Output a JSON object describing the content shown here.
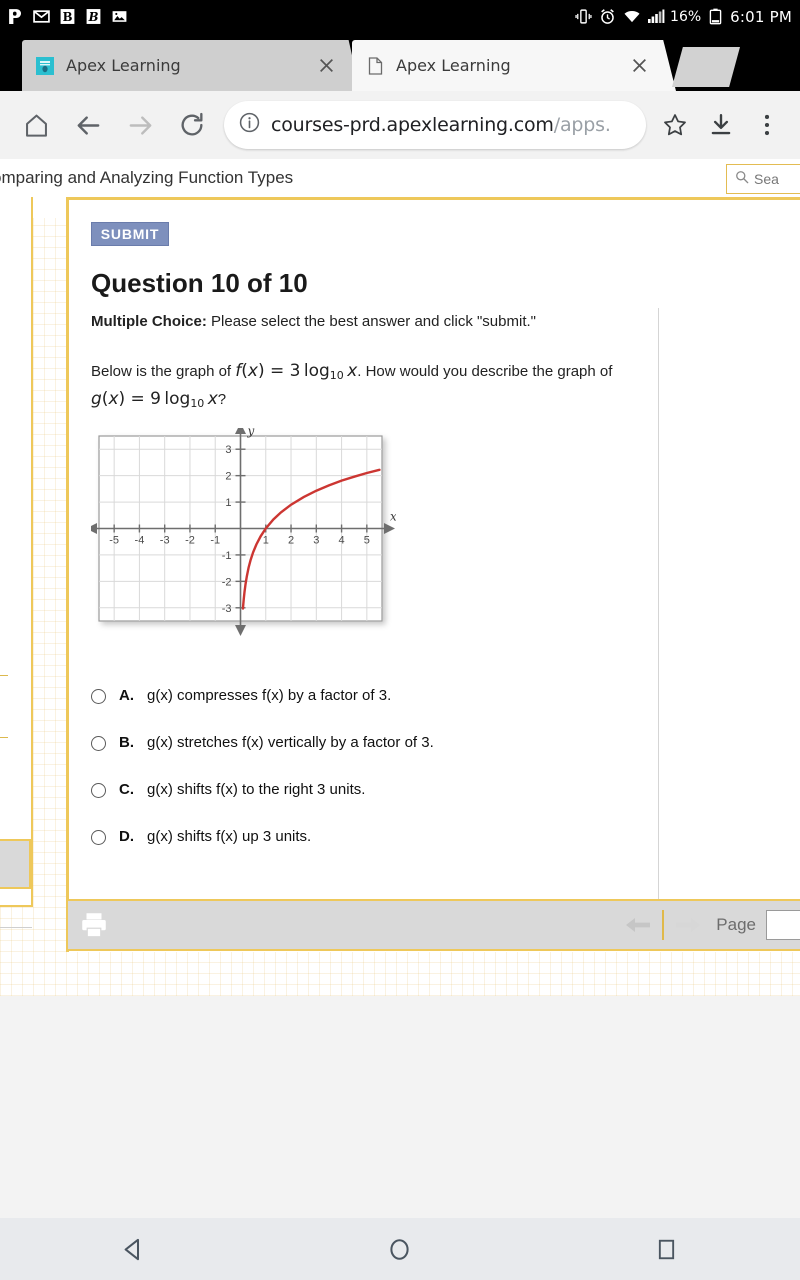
{
  "status_bar": {
    "notification_icons": [
      "pandora-p-icon",
      "gmail-m-icon",
      "b-app-icon",
      "b-app-icon-2",
      "photo-icon"
    ],
    "vibrate_icon": "vibrate-icon",
    "alarm_icon": "alarm-icon",
    "wifi_icon": "wifi-icon",
    "signal_icon": "signal-bars-icon",
    "battery_percent": "16%",
    "battery_icon": "battery-icon",
    "clock": "6:01 PM"
  },
  "browser": {
    "tabs": [
      {
        "title": "Apex Learning",
        "favicon": "apex-favicon",
        "active": false,
        "close_label": "×"
      },
      {
        "title": "Apex Learning",
        "favicon": "page-icon",
        "active": true,
        "close_label": "×"
      }
    ],
    "toolbar": {
      "home_icon": "home-icon",
      "back_icon": "back-arrow-icon",
      "forward_icon": "forward-arrow-icon",
      "reload_icon": "reload-icon",
      "info_icon": "page-info-icon",
      "url": "courses-prd.apexlearning.com",
      "url_dim": "/apps.",
      "bookmark_icon": "star-icon",
      "download_icon": "download-icon",
      "menu_icon": "overflow-menu-icon"
    }
  },
  "course": {
    "title": "omparing and Analyzing Function Types",
    "search_placeholder": "Sea",
    "search_icon": "search-icon"
  },
  "quiz": {
    "submit_label": "SUBMIT",
    "question_title": "Question 10 of 10",
    "instruction_bold": "Multiple Choice:",
    "instruction_rest": " Please select the best answer and click \"submit.\"",
    "prompt_part1": "Below is the graph of ",
    "prompt_fx": "f(x) = 3 log10 x",
    "prompt_part2": ". How would you describe the graph of ",
    "prompt_gx": "g(x) = 9 log10 x",
    "prompt_part3": "?",
    "options": [
      {
        "letter": "A.",
        "text": "g(x) compresses f(x) by a factor of 3.",
        "selected": false
      },
      {
        "letter": "B.",
        "text": "g(x) stretches f(x) vertically by a factor of 3.",
        "selected": false
      },
      {
        "letter": "C.",
        "text": "g(x) shifts f(x) to the right 3 units.",
        "selected": false
      },
      {
        "letter": "D.",
        "text": "g(x) shifts f(x) up 3 units.",
        "selected": false
      }
    ]
  },
  "chart_data": {
    "type": "line",
    "title": "",
    "xlabel": "x",
    "ylabel": "y",
    "xlim": [
      -5.6,
      5.6
    ],
    "ylim": [
      -3.5,
      3.5
    ],
    "grid": true,
    "x_ticks": [
      -5,
      -4,
      -3,
      -2,
      -1,
      1,
      2,
      3,
      4,
      5
    ],
    "y_ticks": [
      -3,
      -2,
      -1,
      1,
      2,
      3
    ],
    "legend": "none",
    "series": [
      {
        "name": "f(x) = 3 log10 x",
        "color": "#cc3632",
        "x": [
          0.097,
          0.11,
          0.13,
          0.16,
          0.2,
          0.25,
          0.32,
          0.4,
          0.5,
          0.63,
          0.8,
          1.0,
          1.3,
          1.6,
          2.0,
          2.5,
          3.0,
          3.5,
          4.0,
          4.5,
          5.0,
          5.5
        ],
        "y": [
          -3.03,
          -2.87,
          -2.66,
          -2.39,
          -2.1,
          -1.81,
          -1.48,
          -1.19,
          -0.9,
          -0.6,
          -0.29,
          0.0,
          0.34,
          0.61,
          0.9,
          1.19,
          1.43,
          1.63,
          1.81,
          1.96,
          2.1,
          2.22
        ]
      }
    ]
  },
  "bottom_toolbar": {
    "print_icon": "print-icon",
    "prev_icon": "prev-page-arrow-icon",
    "next_icon": "next-page-arrow-icon",
    "page_label": "Page",
    "page_value": ""
  },
  "android_nav": {
    "back_icon": "nav-back-triangle-icon",
    "home_icon": "nav-home-circle-icon",
    "recents_icon": "nav-recents-square-icon"
  }
}
